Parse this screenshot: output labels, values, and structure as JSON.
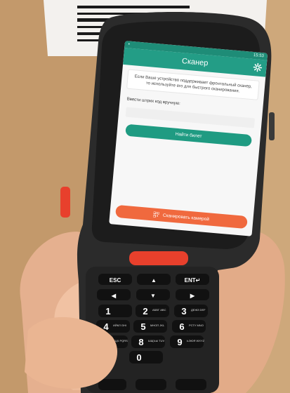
{
  "screen": {
    "status_time": "15:53",
    "app_title": "Сканер",
    "hint_text": "Если Ваше устройство поддерживает фронтальный сканер, то используйте его для быстрого сканирования.",
    "manual_label": "Ввести штрих код вручную:",
    "barcode_placeholder": "",
    "find_button": "Найти билет",
    "scan_camera_button": "Сканировать камерой"
  },
  "keypad": {
    "top_row": [
      "ESC",
      "▲",
      "ENT↵"
    ],
    "digits": [
      {
        "num": "1",
        "sub": ""
      },
      {
        "num": "2",
        "sub": "АБВГ ABC"
      },
      {
        "num": "3",
        "sub": "ДЕЖЗ DEF"
      },
      {
        "num": "4",
        "sub": "ИЙКЛ GHI"
      },
      {
        "num": "5",
        "sub": "МНОП JKL"
      },
      {
        "num": "6",
        "sub": "РСТУ MNO"
      },
      {
        "num": "7",
        "sub": "ФХЦЧ PQRS"
      },
      {
        "num": "8",
        "sub": "ШЩЪЫ TUV"
      },
      {
        "num": "9",
        "sub": "ЬЭЮЯ WXYZ"
      },
      {
        "num": "0",
        "sub": ""
      }
    ]
  },
  "colors": {
    "app_green": "#239d86",
    "scan_orange": "#f0693e",
    "device_body": "#2a2a2a",
    "trigger_red": "#e8402c",
    "cardboard": "#c9a477"
  }
}
